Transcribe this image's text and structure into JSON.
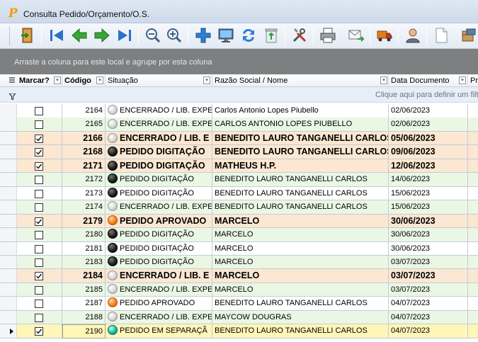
{
  "window": {
    "title": "Consulta Pedido/Orçamento/O.S.",
    "app_icon_letter": "P"
  },
  "toolbar": {
    "buttons": [
      {
        "icon": "exit-door-icon"
      },
      {
        "icon": "first-record-icon"
      },
      {
        "icon": "previous-record-icon"
      },
      {
        "icon": "next-record-icon"
      },
      {
        "icon": "last-record-icon"
      },
      {
        "icon": "zoom-out-icon"
      },
      {
        "icon": "zoom-in-icon"
      },
      {
        "icon": "add-icon"
      },
      {
        "icon": "monitor-icon"
      },
      {
        "icon": "refresh-icon"
      },
      {
        "icon": "recycle-bin-icon"
      },
      {
        "icon": "tools-icon"
      },
      {
        "icon": "printer-icon"
      },
      {
        "icon": "send-email-icon"
      },
      {
        "icon": "delivery-truck-icon"
      },
      {
        "icon": "user-icon"
      },
      {
        "icon": "document-icon"
      },
      {
        "icon": "package-icon"
      }
    ]
  },
  "group_panel": {
    "text": "Arraste a coluna para este local e agrupe por esta coluna"
  },
  "columns": {
    "marcar": "Marcar?",
    "codigo": "Código",
    "situacao": "Situação",
    "razao": "Razão Social / Nome",
    "data": "Data Documento",
    "pr": "Pr"
  },
  "filter_row": {
    "text": "Clique aqui para definir um filtro"
  },
  "rows": [
    {
      "checked": false,
      "codigo": "2164",
      "status_color": "gray",
      "situacao": "ENCERRADO / LIB. EXPED",
      "razao": "Carlos Antonio Lopes Piubello",
      "data": "02/06/2023",
      "bold": false
    },
    {
      "checked": false,
      "codigo": "2165",
      "status_color": "gray",
      "situacao": "ENCERRADO / LIB. EXPED",
      "razao": "CARLOS ANTONIO LOPES PIUBELLO",
      "data": "02/06/2023",
      "bold": false
    },
    {
      "checked": true,
      "codigo": "2166",
      "status_color": "gray",
      "situacao": "ENCERRADO / LIB. E",
      "razao": "BENEDITO LAURO TANGANELLI CARLOS",
      "data": "05/06/2023",
      "bold": true
    },
    {
      "checked": true,
      "codigo": "2168",
      "status_color": "black",
      "situacao": "PEDIDO DIGITAÇÃO",
      "razao": "BENEDITO LAURO TANGANELLI CARLOS",
      "data": "09/06/2023",
      "bold": true
    },
    {
      "checked": true,
      "codigo": "2171",
      "status_color": "black",
      "situacao": "PEDIDO DIGITAÇÃO",
      "razao": "MATHEUS H.P.",
      "data": "12/06/2023",
      "bold": true
    },
    {
      "checked": false,
      "codigo": "2172",
      "status_color": "black",
      "situacao": "PEDIDO DIGITAÇÃO",
      "razao": "BENEDITO LAURO TANGANELLI CARLOS",
      "data": "14/06/2023",
      "bold": false
    },
    {
      "checked": false,
      "codigo": "2173",
      "status_color": "black",
      "situacao": "PEDIDO DIGITAÇÃO",
      "razao": "BENEDITO LAURO TANGANELLI CARLOS",
      "data": "15/06/2023",
      "bold": false
    },
    {
      "checked": false,
      "codigo": "2174",
      "status_color": "gray",
      "situacao": "ENCERRADO / LIB. EXPED",
      "razao": "BENEDITO LAURO TANGANELLI CARLOS",
      "data": "15/06/2023",
      "bold": false
    },
    {
      "checked": true,
      "codigo": "2179",
      "status_color": "orange",
      "situacao": "PEDIDO APROVADO",
      "razao": "MARCELO",
      "data": "30/06/2023",
      "bold": true
    },
    {
      "checked": false,
      "codigo": "2180",
      "status_color": "black",
      "situacao": "PEDIDO DIGITAÇÃO",
      "razao": "MARCELO",
      "data": "30/06/2023",
      "bold": false
    },
    {
      "checked": false,
      "codigo": "2181",
      "status_color": "black",
      "situacao": "PEDIDO DIGITAÇÃO",
      "razao": "MARCELO",
      "data": "30/06/2023",
      "bold": false
    },
    {
      "checked": false,
      "codigo": "2183",
      "status_color": "black",
      "situacao": "PEDIDO DIGITAÇÃO",
      "razao": "MARCELO",
      "data": "03/07/2023",
      "bold": false
    },
    {
      "checked": true,
      "codigo": "2184",
      "status_color": "gray",
      "situacao": "ENCERRADO / LIB. E",
      "razao": "MARCELO",
      "data": "03/07/2023",
      "bold": true
    },
    {
      "checked": false,
      "codigo": "2185",
      "status_color": "gray",
      "situacao": "ENCERRADO / LIB. EXPED",
      "razao": "MARCELO",
      "data": "03/07/2023",
      "bold": false
    },
    {
      "checked": false,
      "codigo": "2187",
      "status_color": "orange",
      "situacao": "PEDIDO APROVADO",
      "razao": "BENEDITO LAURO TANGANELLI CARLOS",
      "data": "04/07/2023",
      "bold": false
    },
    {
      "checked": false,
      "codigo": "2188",
      "status_color": "gray",
      "situacao": "ENCERRADO / LIB. EXPED",
      "razao": "MAYCOW DOUGRAS",
      "data": "04/07/2023",
      "bold": false
    },
    {
      "checked": true,
      "codigo": "2190",
      "status_color": "teal",
      "situacao": "PEDIDO EM SEPARAÇÃ",
      "razao": "BENEDITO LAURO TANGANELLI CARLOS",
      "data": "04/07/2023",
      "bold": false,
      "current": true
    }
  ],
  "colors": {
    "even_row": "#ffffff",
    "odd_row": "#e9f7e4",
    "bold_row": "#fbe7d2",
    "current_row": "#fff6b8"
  }
}
